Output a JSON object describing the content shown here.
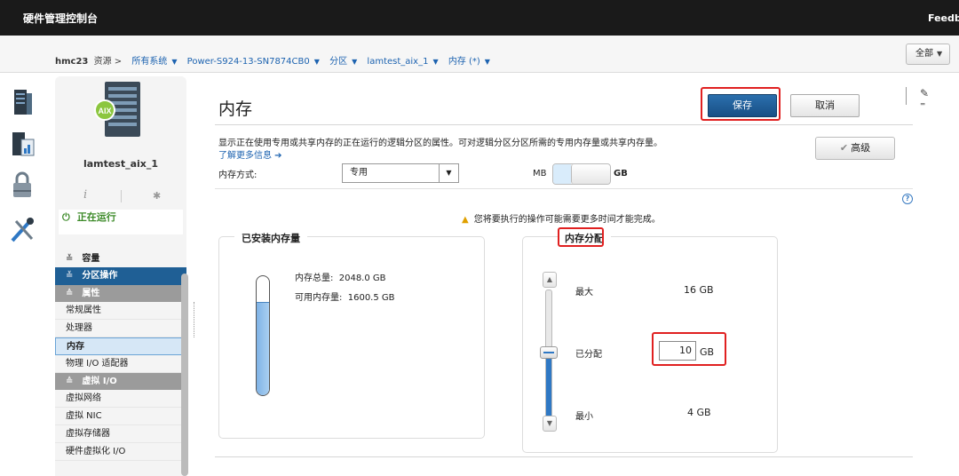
{
  "app": {
    "title": "硬件管理控制台",
    "feedback": "Feedba"
  },
  "breadcrumb": {
    "host": "hmc23",
    "resources": "资源 >",
    "items": [
      "所有系统",
      "Power-S924-13-SN7874CB0",
      "分区",
      "lamtest_aix_1",
      "内存 (*)"
    ]
  },
  "scope": {
    "label": "全部"
  },
  "rail": {
    "icons": [
      "server-icon",
      "performance-icon",
      "security-lock-icon",
      "tools-icon"
    ]
  },
  "partition": {
    "name": "lamtest_aix_1",
    "badge": "AIX",
    "status": "正在运行",
    "status_color": "#3c8a28"
  },
  "nav": {
    "capacity": "容量",
    "section": "分区操作",
    "group_properties": "属性",
    "items_properties": [
      "常规属性",
      "处理器",
      "内存",
      "物理 I/O 适配器"
    ],
    "selected": "内存",
    "group_vio": "虚拟 I/O",
    "items_vio": [
      "虚拟网络",
      "虚拟 NIC",
      "虚拟存储器",
      "硬件虚拟化 I/O"
    ]
  },
  "page": {
    "title": "内存",
    "save": "保存",
    "cancel": "取消",
    "description": "显示正在使用专用或共享内存的正在运行的逻辑分区的属性。可对逻辑分区分区所需的专用内存量或共享内存量。",
    "learn_more": "了解更多信息 ➔",
    "advanced": "高级",
    "memory_mode_label": "内存方式:",
    "memory_mode_value": "专用",
    "unit_mb": "MB",
    "unit_gb": "GB",
    "warning": "您将要执行的操作可能需要更多时间才能完成。",
    "accent": "#1f5f95",
    "highlight": "#e02020"
  },
  "installed": {
    "legend": "已安装内存量",
    "total_label": "内存总量:",
    "total_value": "2048.0 GB",
    "available_label": "可用内存量:",
    "available_value": "1600.5 GB",
    "used_fraction": 0.78
  },
  "allocation": {
    "legend": "内存分配",
    "max_label": "最大",
    "max_value": "16 GB",
    "assigned_label": "已分配",
    "assigned_value": "10",
    "assigned_unit": "GB",
    "min_label": "最小",
    "min_value": "4 GB",
    "slider_fraction": 0.5
  }
}
